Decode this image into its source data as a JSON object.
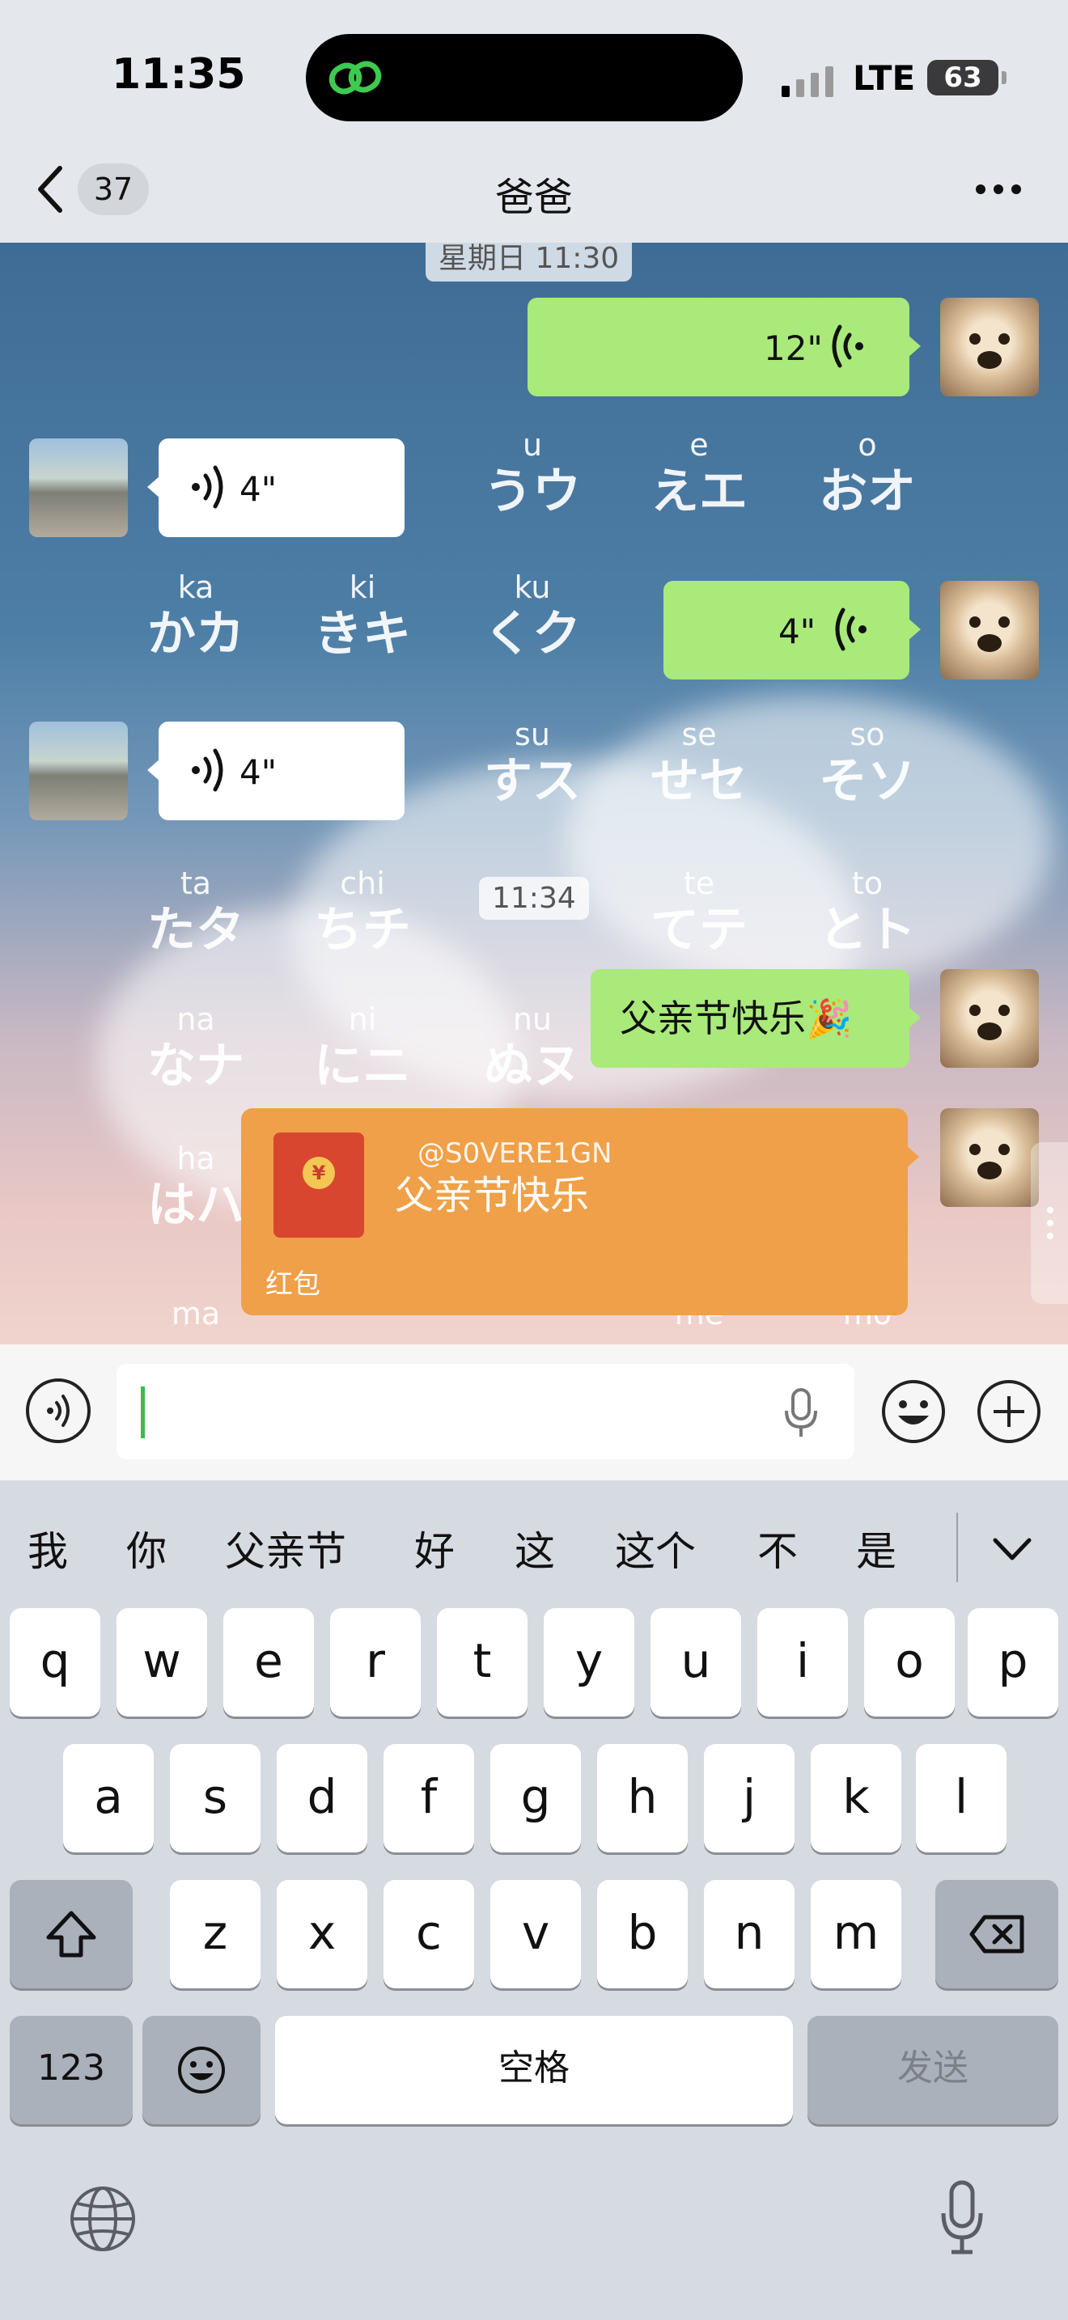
{
  "status_bar": {
    "time": "11:35",
    "network": "LTE",
    "battery": "63"
  },
  "nav": {
    "unread_count": "37",
    "title": "爸爸"
  },
  "chat": {
    "timestamp_top": "星期日 11:30",
    "timestamp_mid": "11:34",
    "background_kana": [
      {
        "romaji": "u",
        "kana": "うウ"
      },
      {
        "romaji": "e",
        "kana": "えエ"
      },
      {
        "romaji": "o",
        "kana": "おオ"
      },
      {
        "romaji": "ka",
        "kana": "かカ"
      },
      {
        "romaji": "ki",
        "kana": "きキ"
      },
      {
        "romaji": "ku",
        "kana": "くク"
      },
      {
        "romaji": "su",
        "kana": "すス"
      },
      {
        "romaji": "se",
        "kana": "せセ"
      },
      {
        "romaji": "so",
        "kana": "そソ"
      },
      {
        "romaji": "ta",
        "kana": "たタ"
      },
      {
        "romaji": "chi",
        "kana": "ちチ"
      },
      {
        "romaji": "te",
        "kana": "てテ"
      },
      {
        "romaji": "to",
        "kana": "とト"
      },
      {
        "romaji": "na",
        "kana": "なナ"
      },
      {
        "romaji": "ni",
        "kana": "にニ"
      },
      {
        "romaji": "nu",
        "kana": "ぬヌ"
      },
      {
        "romaji": "ha",
        "kana": "はハ"
      },
      {
        "romaji": "ma",
        "kana": ""
      },
      {
        "romaji": "me",
        "kana": ""
      },
      {
        "romaji": "mo",
        "kana": ""
      }
    ],
    "messages": [
      {
        "sender": "me",
        "type": "voice",
        "duration": "12\""
      },
      {
        "sender": "dad",
        "type": "voice",
        "duration": "4\""
      },
      {
        "sender": "me",
        "type": "voice",
        "duration": "4\""
      },
      {
        "sender": "dad",
        "type": "voice",
        "duration": "4\""
      },
      {
        "sender": "me",
        "type": "text",
        "text": "父亲节快乐🎉"
      },
      {
        "sender": "me",
        "type": "red_packet",
        "title": "父亲节快乐",
        "label": "红包",
        "watermark": "@S0VERE1GN"
      }
    ]
  },
  "input": {
    "placeholder": ""
  },
  "candidates": [
    "我",
    "你",
    "父亲节",
    "好",
    "这",
    "这个",
    "不",
    "是"
  ],
  "keyboard": {
    "row1": [
      "q",
      "w",
      "e",
      "r",
      "t",
      "y",
      "u",
      "i",
      "o",
      "p"
    ],
    "row2": [
      "a",
      "s",
      "d",
      "f",
      "g",
      "h",
      "j",
      "k",
      "l"
    ],
    "row3": [
      "z",
      "x",
      "c",
      "v",
      "b",
      "n",
      "m"
    ],
    "numbers_key": "123",
    "space_key": "空格",
    "send_key": "发送"
  },
  "colors": {
    "bubble_green": "#a9ea7a",
    "red_packet": "#f0a048",
    "cursor": "#3fb950"
  }
}
